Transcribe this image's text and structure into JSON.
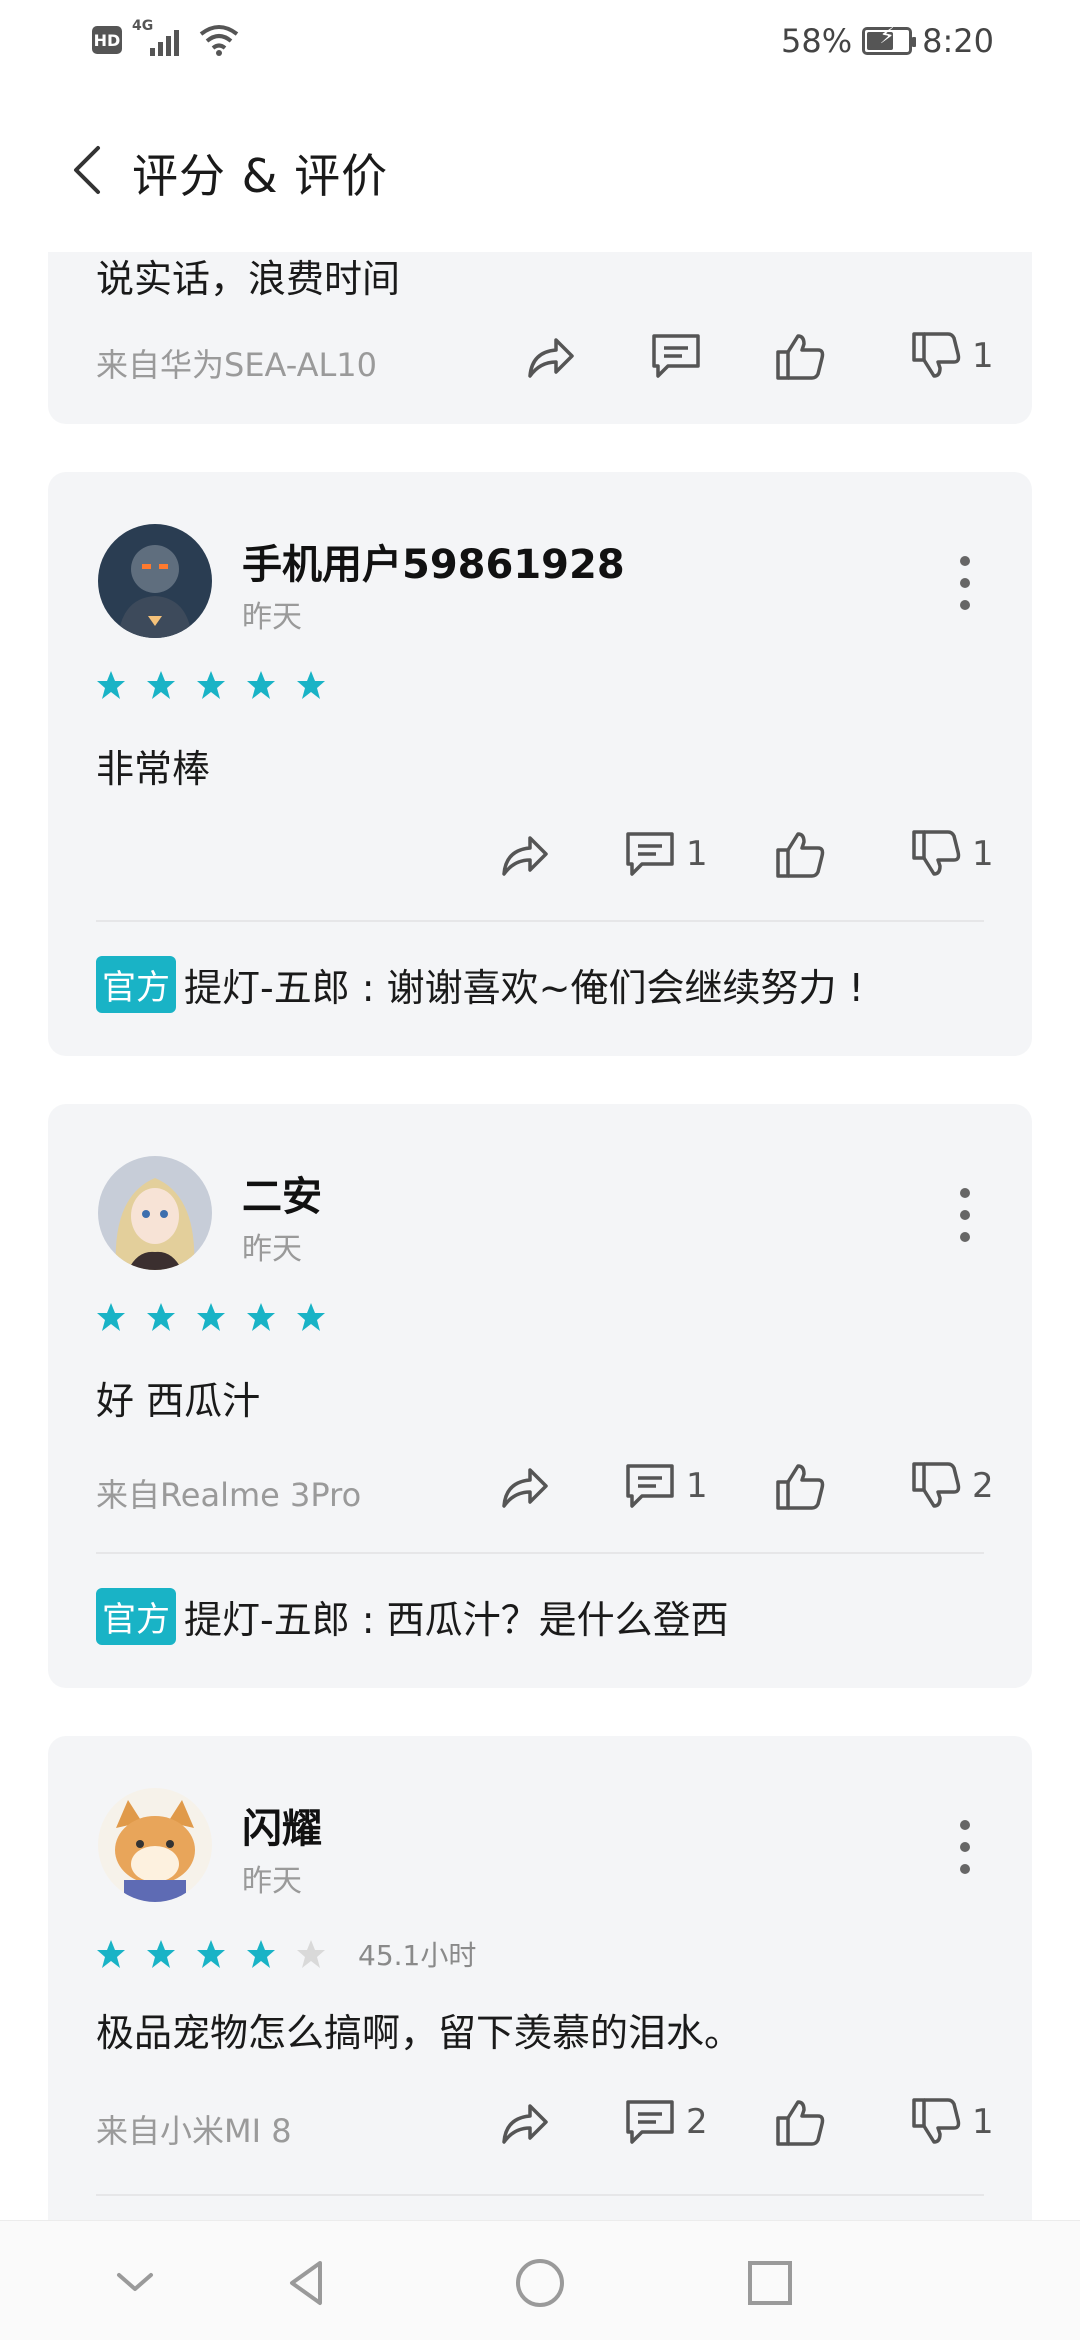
{
  "status": {
    "hd": "HD",
    "network": "4G",
    "battery": "58%",
    "time": "8:20"
  },
  "header": {
    "title": "评分 & 评价"
  },
  "reviews": [
    {
      "text": "说实话，浪费时间",
      "device": "来自华为SEA-AL10",
      "comments": "",
      "dislikes": "1"
    },
    {
      "user": "手机用户59861928",
      "date": "昨天",
      "rating": 5,
      "text": "非常棒",
      "comments": "1",
      "dislikes": "1",
      "reply_badge": "官方",
      "reply": "提灯-五郎 : 谢谢喜欢~俺们会继续努力 !"
    },
    {
      "user": "二安",
      "date": "昨天",
      "rating": 5,
      "text": "好 西瓜汁",
      "device": "来自Realme 3Pro",
      "comments": "1",
      "dislikes": "2",
      "reply_badge": "官方",
      "reply": "提灯-五郎 : 西瓜汁？是什么登西"
    },
    {
      "user": "闪耀",
      "date": "昨天",
      "rating": 4,
      "duration": "45.1小时",
      "text": "极品宠物怎么搞啊，留下羡慕的泪水。",
      "device": "来自小米MI 8",
      "comments": "2",
      "dislikes": "1"
    }
  ],
  "colors": {
    "accent": "#19b3c6",
    "card": "#f4f5f7",
    "star_empty": "#d9d9d9"
  },
  "icons": [
    "share-icon",
    "comment-icon",
    "thumbs-up-icon",
    "thumbs-down-icon",
    "more-icon",
    "back-icon"
  ]
}
